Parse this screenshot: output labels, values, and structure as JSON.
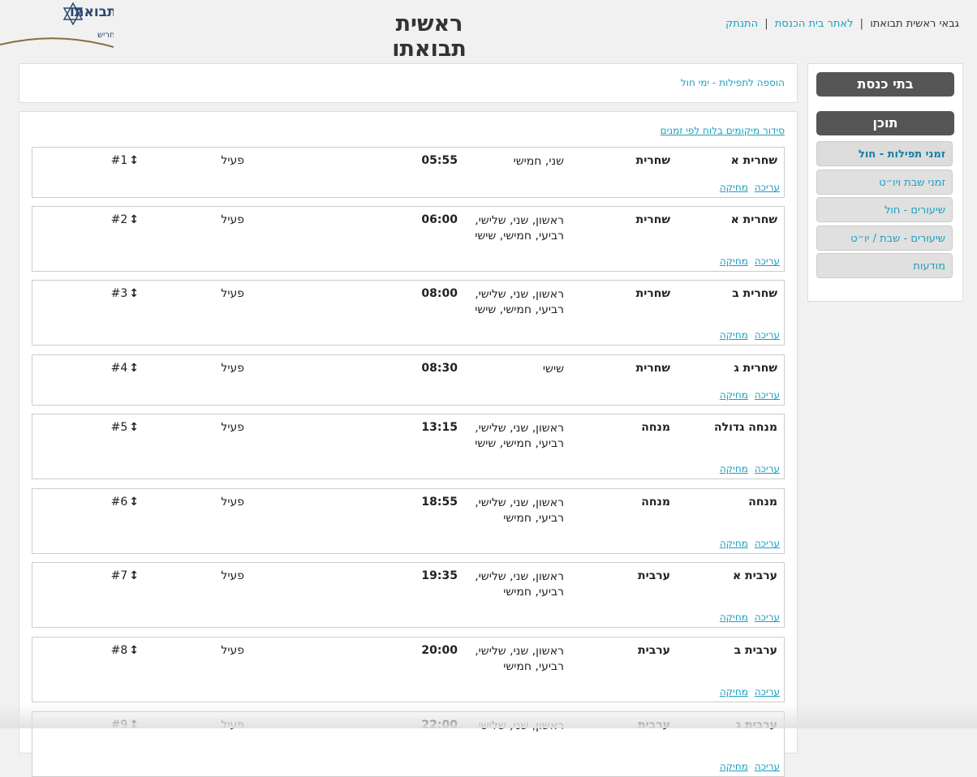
{
  "header": {
    "site_title": "ראשית תבואתו",
    "user_label": "גבאי ראשית תבואתו",
    "to_synagogue_link": "לאתר בית הכנסת",
    "logout_link": "התנתק",
    "separator": "|",
    "logo": {
      "title": "ראשית תבואתו",
      "subtitle": "גרעין תורני קהילתי חריש"
    }
  },
  "sidebar": {
    "synagogues_header": "בתי כנסת",
    "content_header": "תוכן",
    "items": [
      {
        "label": "זמני תפילות - חול",
        "active": true
      },
      {
        "label": "זמני שבת ויו״ט",
        "active": false
      },
      {
        "label": "שיעורים - חול",
        "active": false
      },
      {
        "label": "שיעורים - שבת / יו״ט",
        "active": false
      },
      {
        "label": "מודעות",
        "active": false
      }
    ]
  },
  "main": {
    "add_link": "הוספה לתפילות - ימי חול",
    "sort_link": "סידור מיקומים בלוח לפי זמנים",
    "edit_label": "עריכה",
    "delete_label": "מחיקה",
    "rows": [
      {
        "name": "שחרית א",
        "type": "שחרית",
        "days": "שני, חמישי",
        "time": "05:55",
        "status": "פעיל",
        "order": "#1"
      },
      {
        "name": "שחרית א",
        "type": "שחרית",
        "days": "ראשון, שני, שלישי, רביעי, חמישי, שישי",
        "time": "06:00",
        "status": "פעיל",
        "order": "#2"
      },
      {
        "name": "שחרית ב",
        "type": "שחרית",
        "days": "ראשון, שני, שלישי, רביעי, חמישי, שישי",
        "time": "08:00",
        "status": "פעיל",
        "order": "#3"
      },
      {
        "name": "שחרית ג",
        "type": "שחרית",
        "days": "שישי",
        "time": "08:30",
        "status": "פעיל",
        "order": "#4"
      },
      {
        "name": "מנחה גדולה",
        "type": "מנחה",
        "days": "ראשון, שני, שלישי, רביעי, חמישי, שישי",
        "time": "13:15",
        "status": "פעיל",
        "order": "#5"
      },
      {
        "name": "מנחה",
        "type": "מנחה",
        "days": "ראשון, שני, שלישי, רביעי, חמישי",
        "time": "18:55",
        "status": "פעיל",
        "order": "#6"
      },
      {
        "name": "ערבית א",
        "type": "ערבית",
        "days": "ראשון, שני, שלישי, רביעי, חמישי",
        "time": "19:35",
        "status": "פעיל",
        "order": "#7"
      },
      {
        "name": "ערבית ב",
        "type": "ערבית",
        "days": "ראשון, שני, שלישי, רביעי, חמישי",
        "time": "20:00",
        "status": "פעיל",
        "order": "#8"
      },
      {
        "name": "ערבית ג",
        "type": "ערבית",
        "days": "ראשון, שני, שלישי",
        "time": "22:00",
        "status": "פעיל",
        "order": "#9"
      }
    ]
  },
  "colors": {
    "link": "#1a9fbf",
    "sidebar_header": "#555555",
    "active_item": "#1380a0"
  },
  "icons": {
    "order_handle": "up-down-arrow-icon",
    "logo": "star-of-david-icon"
  }
}
